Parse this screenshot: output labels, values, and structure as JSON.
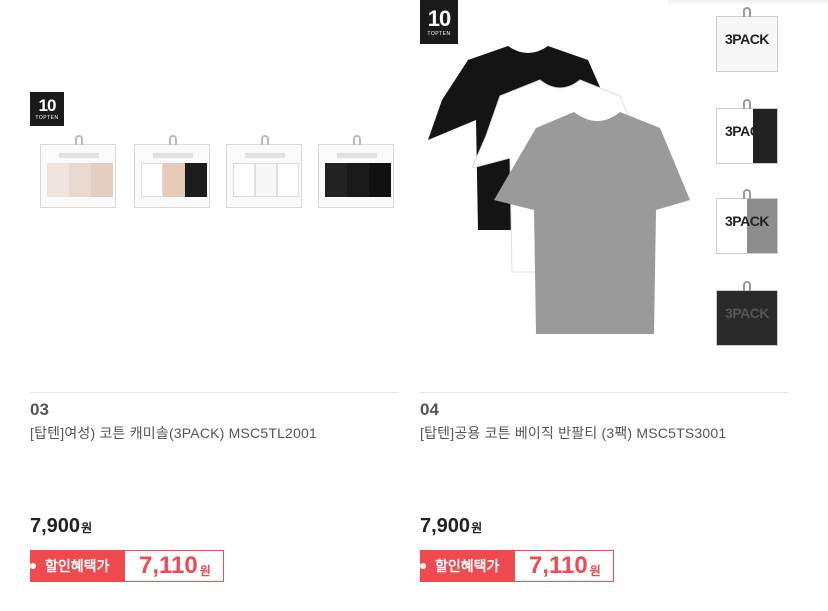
{
  "products": [
    {
      "rank": "03",
      "title": "[탑텐]여성) 코튼 캐미솔(3PACK) MSC5TL2001",
      "price": "7,900",
      "price_unit": "원",
      "discount_label": "할인혜택가",
      "discount_price": "7,110",
      "discount_unit": "원",
      "brand": "10",
      "brand_sub": "TOPTEN"
    },
    {
      "rank": "04",
      "title": "[탑텐]공용 코튼 베이직 반팔티 (3팩) MSC5TS3001",
      "price": "7,900",
      "price_unit": "원",
      "discount_label": "할인혜택가",
      "discount_price": "7,110",
      "discount_unit": "원",
      "brand": "10",
      "brand_sub": "TOPTEN",
      "pack_text": "3PACK"
    }
  ],
  "colors": {
    "accent": "#ef4a4f",
    "text": "#333333",
    "divider": "#e6e6e6"
  }
}
